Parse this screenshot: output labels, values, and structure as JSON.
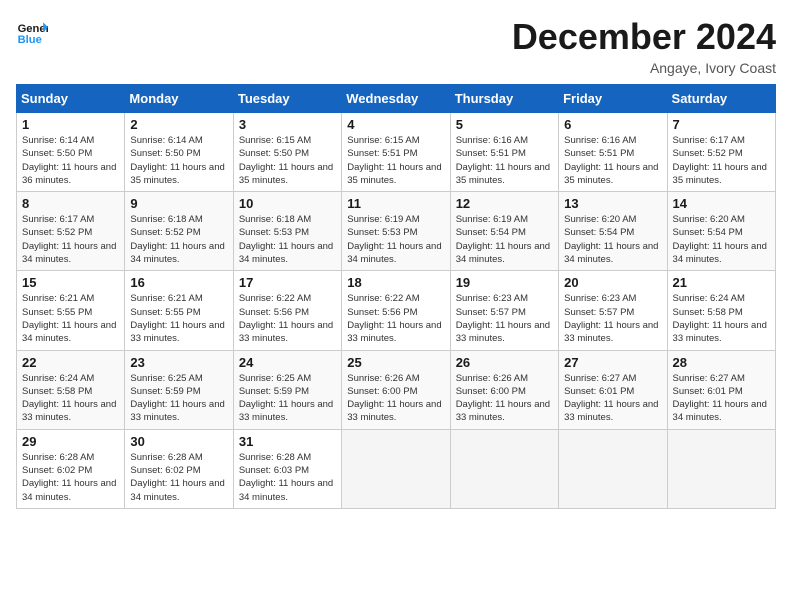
{
  "logo": {
    "name": "General",
    "name2": "Blue"
  },
  "title": "December 2024",
  "subtitle": "Angaye, Ivory Coast",
  "days_of_week": [
    "Sunday",
    "Monday",
    "Tuesday",
    "Wednesday",
    "Thursday",
    "Friday",
    "Saturday"
  ],
  "weeks": [
    [
      {
        "day": "1",
        "sunrise": "Sunrise: 6:14 AM",
        "sunset": "Sunset: 5:50 PM",
        "daylight": "Daylight: 11 hours and 36 minutes."
      },
      {
        "day": "2",
        "sunrise": "Sunrise: 6:14 AM",
        "sunset": "Sunset: 5:50 PM",
        "daylight": "Daylight: 11 hours and 35 minutes."
      },
      {
        "day": "3",
        "sunrise": "Sunrise: 6:15 AM",
        "sunset": "Sunset: 5:50 PM",
        "daylight": "Daylight: 11 hours and 35 minutes."
      },
      {
        "day": "4",
        "sunrise": "Sunrise: 6:15 AM",
        "sunset": "Sunset: 5:51 PM",
        "daylight": "Daylight: 11 hours and 35 minutes."
      },
      {
        "day": "5",
        "sunrise": "Sunrise: 6:16 AM",
        "sunset": "Sunset: 5:51 PM",
        "daylight": "Daylight: 11 hours and 35 minutes."
      },
      {
        "day": "6",
        "sunrise": "Sunrise: 6:16 AM",
        "sunset": "Sunset: 5:51 PM",
        "daylight": "Daylight: 11 hours and 35 minutes."
      },
      {
        "day": "7",
        "sunrise": "Sunrise: 6:17 AM",
        "sunset": "Sunset: 5:52 PM",
        "daylight": "Daylight: 11 hours and 35 minutes."
      }
    ],
    [
      {
        "day": "8",
        "sunrise": "Sunrise: 6:17 AM",
        "sunset": "Sunset: 5:52 PM",
        "daylight": "Daylight: 11 hours and 34 minutes."
      },
      {
        "day": "9",
        "sunrise": "Sunrise: 6:18 AM",
        "sunset": "Sunset: 5:52 PM",
        "daylight": "Daylight: 11 hours and 34 minutes."
      },
      {
        "day": "10",
        "sunrise": "Sunrise: 6:18 AM",
        "sunset": "Sunset: 5:53 PM",
        "daylight": "Daylight: 11 hours and 34 minutes."
      },
      {
        "day": "11",
        "sunrise": "Sunrise: 6:19 AM",
        "sunset": "Sunset: 5:53 PM",
        "daylight": "Daylight: 11 hours and 34 minutes."
      },
      {
        "day": "12",
        "sunrise": "Sunrise: 6:19 AM",
        "sunset": "Sunset: 5:54 PM",
        "daylight": "Daylight: 11 hours and 34 minutes."
      },
      {
        "day": "13",
        "sunrise": "Sunrise: 6:20 AM",
        "sunset": "Sunset: 5:54 PM",
        "daylight": "Daylight: 11 hours and 34 minutes."
      },
      {
        "day": "14",
        "sunrise": "Sunrise: 6:20 AM",
        "sunset": "Sunset: 5:54 PM",
        "daylight": "Daylight: 11 hours and 34 minutes."
      }
    ],
    [
      {
        "day": "15",
        "sunrise": "Sunrise: 6:21 AM",
        "sunset": "Sunset: 5:55 PM",
        "daylight": "Daylight: 11 hours and 34 minutes."
      },
      {
        "day": "16",
        "sunrise": "Sunrise: 6:21 AM",
        "sunset": "Sunset: 5:55 PM",
        "daylight": "Daylight: 11 hours and 33 minutes."
      },
      {
        "day": "17",
        "sunrise": "Sunrise: 6:22 AM",
        "sunset": "Sunset: 5:56 PM",
        "daylight": "Daylight: 11 hours and 33 minutes."
      },
      {
        "day": "18",
        "sunrise": "Sunrise: 6:22 AM",
        "sunset": "Sunset: 5:56 PM",
        "daylight": "Daylight: 11 hours and 33 minutes."
      },
      {
        "day": "19",
        "sunrise": "Sunrise: 6:23 AM",
        "sunset": "Sunset: 5:57 PM",
        "daylight": "Daylight: 11 hours and 33 minutes."
      },
      {
        "day": "20",
        "sunrise": "Sunrise: 6:23 AM",
        "sunset": "Sunset: 5:57 PM",
        "daylight": "Daylight: 11 hours and 33 minutes."
      },
      {
        "day": "21",
        "sunrise": "Sunrise: 6:24 AM",
        "sunset": "Sunset: 5:58 PM",
        "daylight": "Daylight: 11 hours and 33 minutes."
      }
    ],
    [
      {
        "day": "22",
        "sunrise": "Sunrise: 6:24 AM",
        "sunset": "Sunset: 5:58 PM",
        "daylight": "Daylight: 11 hours and 33 minutes."
      },
      {
        "day": "23",
        "sunrise": "Sunrise: 6:25 AM",
        "sunset": "Sunset: 5:59 PM",
        "daylight": "Daylight: 11 hours and 33 minutes."
      },
      {
        "day": "24",
        "sunrise": "Sunrise: 6:25 AM",
        "sunset": "Sunset: 5:59 PM",
        "daylight": "Daylight: 11 hours and 33 minutes."
      },
      {
        "day": "25",
        "sunrise": "Sunrise: 6:26 AM",
        "sunset": "Sunset: 6:00 PM",
        "daylight": "Daylight: 11 hours and 33 minutes."
      },
      {
        "day": "26",
        "sunrise": "Sunrise: 6:26 AM",
        "sunset": "Sunset: 6:00 PM",
        "daylight": "Daylight: 11 hours and 33 minutes."
      },
      {
        "day": "27",
        "sunrise": "Sunrise: 6:27 AM",
        "sunset": "Sunset: 6:01 PM",
        "daylight": "Daylight: 11 hours and 33 minutes."
      },
      {
        "day": "28",
        "sunrise": "Sunrise: 6:27 AM",
        "sunset": "Sunset: 6:01 PM",
        "daylight": "Daylight: 11 hours and 34 minutes."
      }
    ],
    [
      {
        "day": "29",
        "sunrise": "Sunrise: 6:28 AM",
        "sunset": "Sunset: 6:02 PM",
        "daylight": "Daylight: 11 hours and 34 minutes."
      },
      {
        "day": "30",
        "sunrise": "Sunrise: 6:28 AM",
        "sunset": "Sunset: 6:02 PM",
        "daylight": "Daylight: 11 hours and 34 minutes."
      },
      {
        "day": "31",
        "sunrise": "Sunrise: 6:28 AM",
        "sunset": "Sunset: 6:03 PM",
        "daylight": "Daylight: 11 hours and 34 minutes."
      },
      null,
      null,
      null,
      null
    ]
  ]
}
